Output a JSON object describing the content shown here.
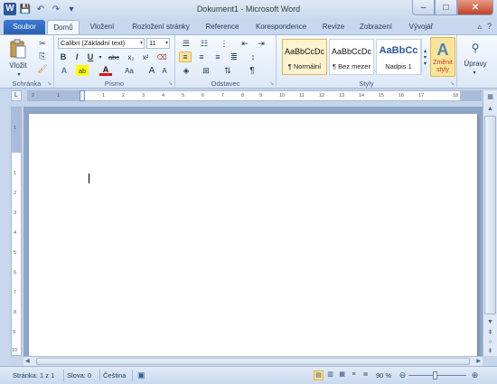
{
  "window": {
    "title": "Dokument1  -  Microsoft Word",
    "app_icon": "W"
  },
  "qat": {
    "save": "💾",
    "undo": "↶",
    "redo": "↷",
    "customize": "▾"
  },
  "tabs": [
    {
      "label": "Soubor"
    },
    {
      "label": "Domů"
    },
    {
      "label": "Vložení"
    },
    {
      "label": "Rozložení stránky"
    },
    {
      "label": "Reference"
    },
    {
      "label": "Korespondence"
    },
    {
      "label": "Revize"
    },
    {
      "label": "Zobrazení"
    },
    {
      "label": "Vývojář"
    }
  ],
  "ribbon": {
    "clipboard": {
      "label": "Schránka",
      "paste": "Vložit"
    },
    "font": {
      "label": "Písmo",
      "font_name": "Calibri (Základní text)",
      "font_size": "11",
      "bold": "B",
      "italic": "I",
      "underline": "U",
      "strike": "abc",
      "subscript": "x₂",
      "superscript": "x²",
      "text_effects": "A",
      "highlight": "ab",
      "font_color": "A",
      "change_case": "Aa",
      "grow": "A",
      "shrink": "A"
    },
    "paragraph": {
      "label": "Odstavec",
      "show_marks": "¶"
    },
    "styles": {
      "label": "Styly",
      "items": [
        {
          "sample": "AaBbCcDc",
          "name": "¶ Normální"
        },
        {
          "sample": "AaBbCcDc",
          "name": "¶ Bez mezer"
        },
        {
          "sample": "AaBbCc",
          "name": "Nadpis 1"
        }
      ],
      "change_styles": "Změnit styly"
    },
    "editing": {
      "label": "Úpravy"
    }
  },
  "ruler": {
    "h_ticks": [
      "2",
      "1",
      "1",
      "2",
      "3",
      "4",
      "5",
      "6",
      "7",
      "8",
      "9",
      "10",
      "11",
      "12",
      "13",
      "14",
      "15",
      "16",
      "17",
      "18"
    ],
    "v_ticks": [
      "1",
      "1",
      "2",
      "3",
      "4",
      "5",
      "6",
      "7",
      "8",
      "9",
      "10"
    ]
  },
  "statusbar": {
    "page": "Stránka: 1 z 1",
    "words": "Slova: 0",
    "language": "Čeština",
    "zoom": "90 %",
    "zoom_percent": 90
  }
}
